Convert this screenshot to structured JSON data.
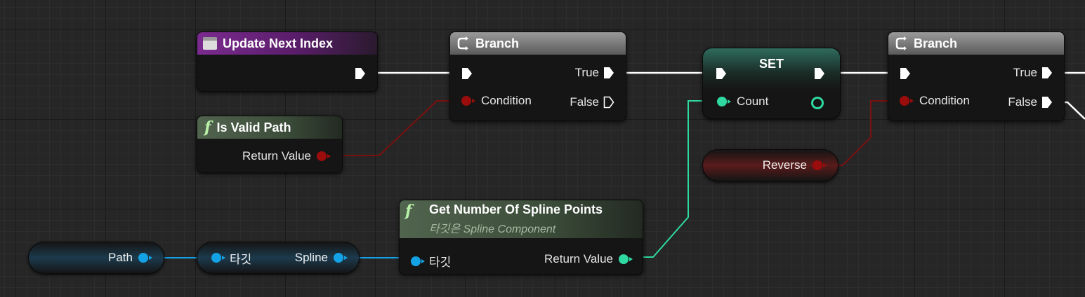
{
  "nodes": {
    "update_next_index": {
      "title": "Update Next Index"
    },
    "branch1": {
      "title": "Branch",
      "true_label": "True",
      "false_label": "False",
      "condition_label": "Condition"
    },
    "is_valid_path": {
      "title": "Is Valid Path",
      "return_label": "Return Value"
    },
    "set": {
      "title": "SET",
      "count_label": "Count"
    },
    "branch2": {
      "title": "Branch",
      "true_label": "True",
      "false_label": "False",
      "condition_label": "Condition"
    },
    "reverse": {
      "label": "Reverse"
    },
    "get_spline": {
      "title": "Get Number Of Spline Points",
      "subtitle": "타깃은 Spline Component",
      "target_label": "타깃",
      "return_label": "Return Value"
    },
    "path": {
      "label": "Path"
    },
    "spline_get": {
      "target_label": "타깃",
      "spline_label": "Spline"
    }
  },
  "colors": {
    "exec": "#ffffff",
    "boolean": "#9b0c0c",
    "object": "#14a2e6",
    "integer": "#2fd9a2"
  },
  "icons": {
    "event": "event-icon",
    "function": "function-icon",
    "branch": "branch-icon"
  }
}
